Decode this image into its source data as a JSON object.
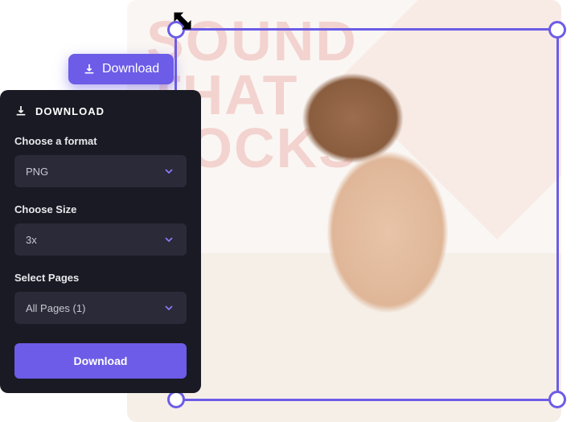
{
  "canvas": {
    "headline_line1": "SOUND",
    "headline_line2": "THAT",
    "headline_line3": "ROCKS"
  },
  "download_button": {
    "label": "Download"
  },
  "panel": {
    "title": "DOWNLOAD",
    "format": {
      "label": "Choose a format",
      "value": "PNG"
    },
    "size": {
      "label": "Choose Size",
      "value": "3x"
    },
    "pages": {
      "label": "Select Pages",
      "value": "All Pages (1)"
    },
    "action_label": "Download"
  },
  "colors": {
    "accent": "#6c5ce7",
    "panel_bg": "#1a1a24",
    "select_bg": "#2a2a38",
    "canvas_bg": "#faf6f3",
    "canvas_text": "#f3d3cf"
  }
}
